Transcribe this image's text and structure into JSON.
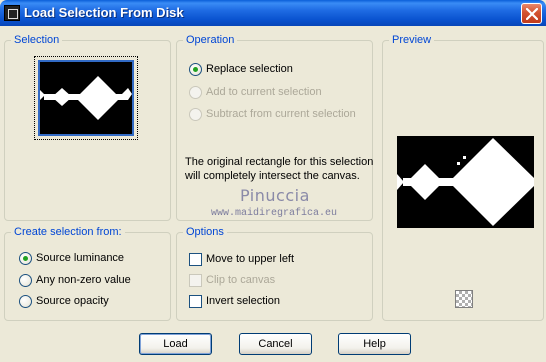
{
  "window": {
    "title": "Load Selection From Disk"
  },
  "colors": {
    "group_label": "#0046d5",
    "title_bar": "#0a53d0",
    "radio_dot": "#21a121"
  },
  "groups": {
    "selection": "Selection",
    "operation": "Operation",
    "preview": "Preview",
    "create_from": "Create selection from:",
    "options": "Options"
  },
  "operation": {
    "replace": "Replace selection",
    "add": "Add to current selection",
    "subtract": "Subtract from current selection",
    "selected": "replace",
    "info_line1": "The original rectangle for this selection",
    "info_line2": "will completely intersect the canvas."
  },
  "watermark": {
    "name": "Pinuccia",
    "url": "www.maidiregrafica.eu"
  },
  "create_from": {
    "luminance": "Source luminance",
    "nonzero": "Any non-zero value",
    "opacity": "Source opacity",
    "selected": "luminance"
  },
  "options": {
    "move_upper_left": "Move to upper left",
    "clip_canvas": "Clip to canvas",
    "invert": "Invert selection"
  },
  "buttons": {
    "load": "Load",
    "cancel": "Cancel",
    "help": "Help"
  },
  "icons": {
    "app": "selection-app-icon",
    "close": "close-icon",
    "transparency": "checkerboard-icon"
  }
}
